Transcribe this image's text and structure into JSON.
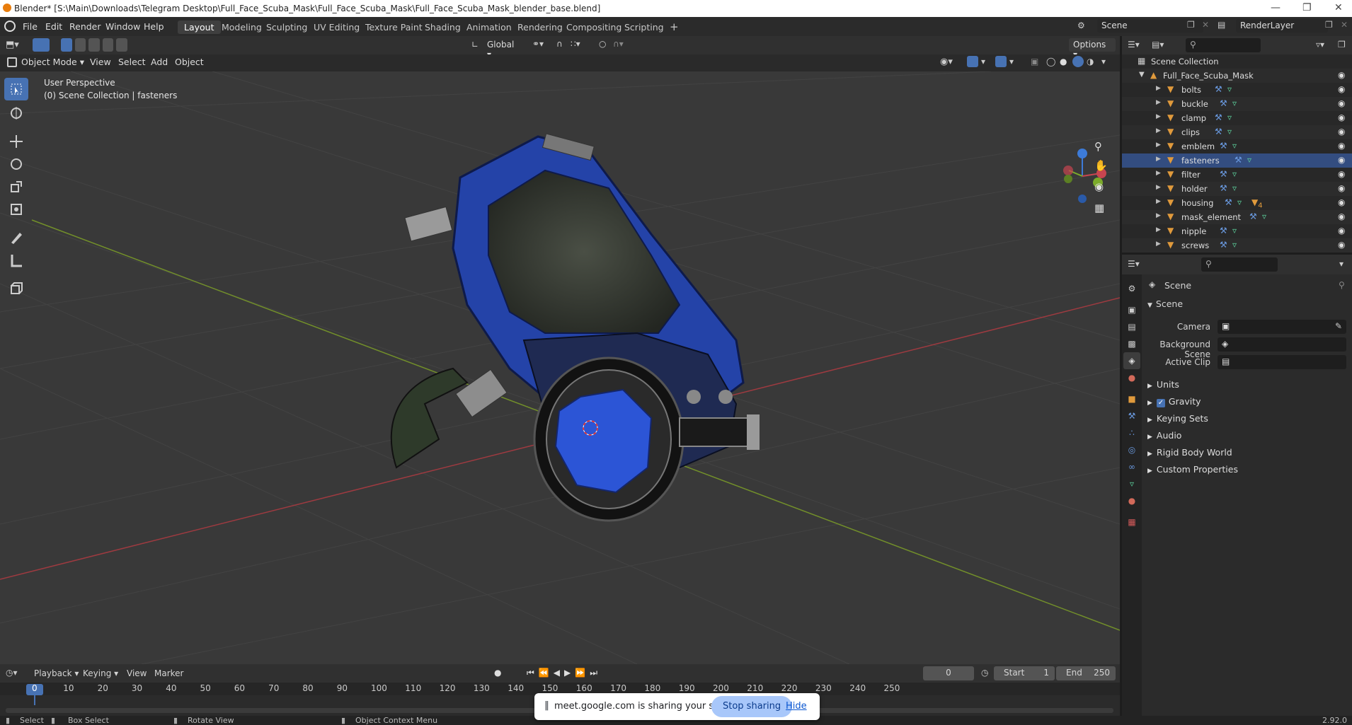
{
  "window": {
    "title": "Blender* [S:\\Main\\Downloads\\Telegram Desktop\\Full_Face_Scuba_Mask\\Full_Face_Scuba_Mask\\Full_Face_Scuba_Mask_blender_base.blend]"
  },
  "menu": [
    "File",
    "Edit",
    "Render",
    "Window",
    "Help"
  ],
  "workspaces": [
    "Layout",
    "Modeling",
    "Sculpting",
    "UV Editing",
    "Texture Paint",
    "Shading",
    "Animation",
    "Rendering",
    "Compositing",
    "Scripting"
  ],
  "active_workspace": "Layout",
  "scene_name": "Scene",
  "render_layer": "RenderLayer",
  "viewport_header": {
    "transform_orientation": "Global",
    "options_label": "Options",
    "mode": "Object Mode",
    "menus": [
      "View",
      "Select",
      "Add",
      "Object"
    ]
  },
  "viewport": {
    "perspective": "User Perspective",
    "context": "(0) Scene Collection | fasteners"
  },
  "outliner": {
    "root": "Scene Collection",
    "collection": "Full_Face_Scuba_Mask",
    "objects": [
      "bolts",
      "buckle",
      "clamp",
      "clips",
      "emblem",
      "fasteners",
      "filter",
      "holder",
      "housing",
      "mask_element",
      "nipple",
      "screws"
    ],
    "housing_material_count": "4"
  },
  "properties": {
    "header": "Scene",
    "panel": "Scene",
    "camera_label": "Camera",
    "background_label": "Background Scene",
    "clip_label": "Active Clip",
    "sections": [
      "Units",
      "Gravity",
      "Keying Sets",
      "Audio",
      "Rigid Body World",
      "Custom Properties"
    ],
    "gravity_enabled": true
  },
  "timeline": {
    "menus": [
      "Playback",
      "Keying",
      "View",
      "Marker"
    ],
    "current_frame": "0",
    "start_label": "Start",
    "start": "1",
    "end_label": "End",
    "end": "250",
    "ticks": [
      "0",
      "10",
      "20",
      "30",
      "40",
      "50",
      "60",
      "70",
      "80",
      "90",
      "100",
      "110",
      "120",
      "130",
      "140",
      "150",
      "160",
      "170",
      "180",
      "190",
      "200",
      "210",
      "220",
      "230",
      "240",
      "250"
    ]
  },
  "statusbar": {
    "select": "Select",
    "box_select": "Box Select",
    "rotate": "Rotate View",
    "context_menu": "Object Context Menu",
    "version": "2.92.0"
  },
  "screenshare": {
    "message": "meet.google.com is sharing your screen.",
    "stop": "Stop sharing",
    "hide": "Hide"
  },
  "colors": {
    "accent": "#4772b3",
    "mask_blue": "#2a4fc0",
    "object_orange": "#e09a3c",
    "mesh_green": "#5dd39e",
    "x_axis": "#a0383f",
    "y_axis": "#7b9b2a"
  }
}
